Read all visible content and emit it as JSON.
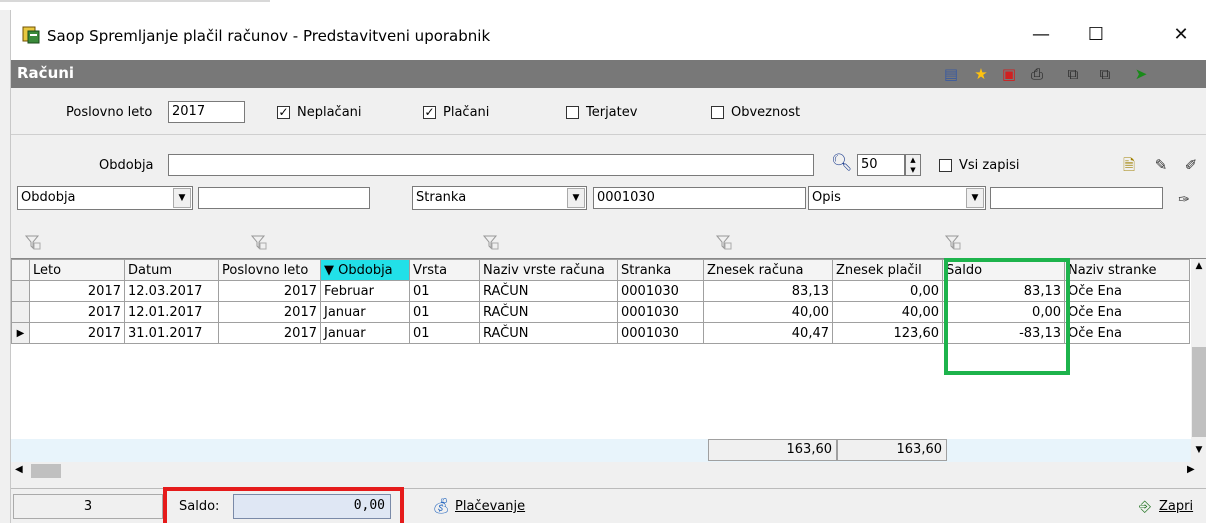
{
  "window": {
    "title": "Saop Spremljanje plačil računov - Predstavitveni uporabnik",
    "minimize": "—",
    "maximize": "☐",
    "close": "✕"
  },
  "panel": {
    "title": "Računi"
  },
  "filters": {
    "poslovno_leto_label": "Poslovno leto",
    "poslovno_leto_value": "2017",
    "neplacani_label": "Neplačani",
    "neplacani_checked": true,
    "placani_label": "Plačani",
    "placani_checked": true,
    "terjatev_label": "Terjatev",
    "terjatev_checked": false,
    "obveznost_label": "Obveznost",
    "obveznost_checked": false,
    "obdobja_label": "Obdobja",
    "obdobja_value": "",
    "records_count": "50",
    "vsi_zapisi_label": "Vsi zapisi",
    "combo1": "Obdobja",
    "combo1_value": "",
    "combo2": "Stranka",
    "combo2_value": "0001030",
    "combo3": "Opis",
    "combo3_value": ""
  },
  "grid": {
    "columns": [
      "Leto",
      "Datum",
      "Poslovno leto",
      "▼ Obdobja",
      "Vrsta",
      "Naziv vrste računa",
      "Stranka",
      "Znesek računa",
      "Znesek plačil",
      "Saldo",
      "Naziv stranke"
    ],
    "rows": [
      [
        "2017",
        "12.03.2017",
        "2017",
        "Februar",
        "01",
        "RAČUN",
        "0001030",
        "83,13",
        "0,00",
        "83,13",
        "Oče Ena"
      ],
      [
        "2017",
        "12.01.2017",
        "2017",
        "Januar",
        "01",
        "RAČUN",
        "0001030",
        "40,00",
        "40,00",
        "0,00",
        "Oče Ena"
      ],
      [
        "2017",
        "31.01.2017",
        "2017",
        "Januar",
        "01",
        "RAČUN",
        "0001030",
        "40,47",
        "123,60",
        "-83,13",
        "Oče Ena"
      ]
    ],
    "current_row_marker": "▶",
    "total_znesek_racuna": "163,60",
    "total_znesek_placil": "163,60"
  },
  "status": {
    "count": "3",
    "saldo_label": "Saldo:",
    "saldo_value": "0,00",
    "placevanje_label": "Plačevanje",
    "zapri_label": "Zapri"
  },
  "colors": {
    "header_bg": "#787878",
    "sorted_col": "#22e0e8",
    "highlight_green": "#1db34c",
    "highlight_red": "#e51b1b"
  }
}
